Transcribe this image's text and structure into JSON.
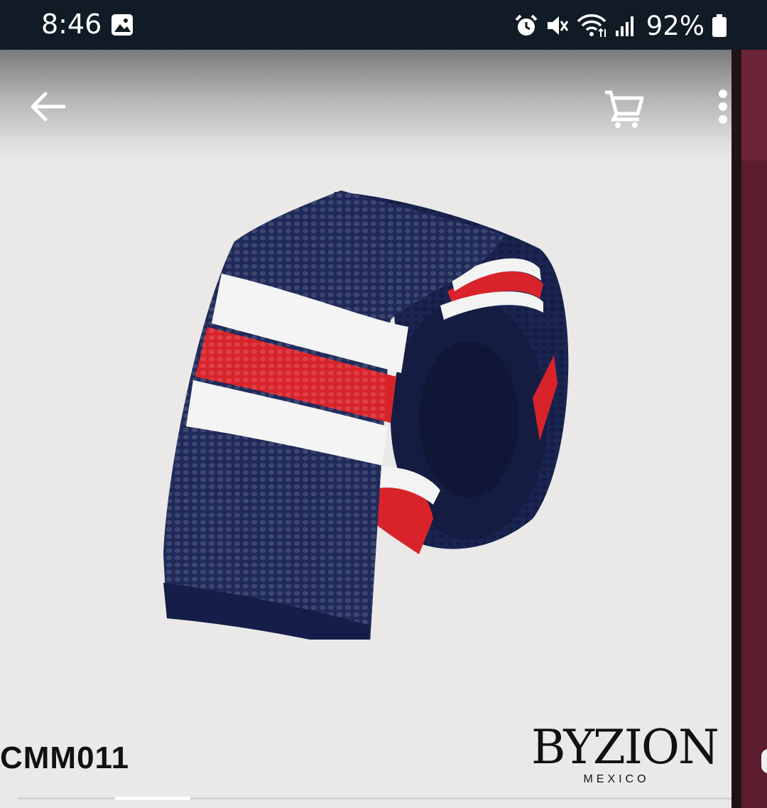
{
  "status_bar": {
    "time": "8:46",
    "battery": "92%",
    "icons": [
      "gallery-icon",
      "alarm-icon",
      "mute-icon",
      "wifi-icon",
      "signal-icon",
      "battery-icon"
    ]
  },
  "toolbar": {
    "icons": [
      "back-arrow-icon",
      "cart-icon",
      "more-vert-icon"
    ]
  },
  "product": {
    "sku": "CMM011",
    "image": "navy knit tie with white and red stripes"
  },
  "brand": {
    "name": "BYZION",
    "subtitle": "MEXICO"
  },
  "colors": {
    "status_bar": "#111b26",
    "background": "#ebe9e8",
    "tie_navy": "#1f2a5a",
    "tie_red": "#d8232a",
    "side_panel": "#5c1c2e"
  }
}
